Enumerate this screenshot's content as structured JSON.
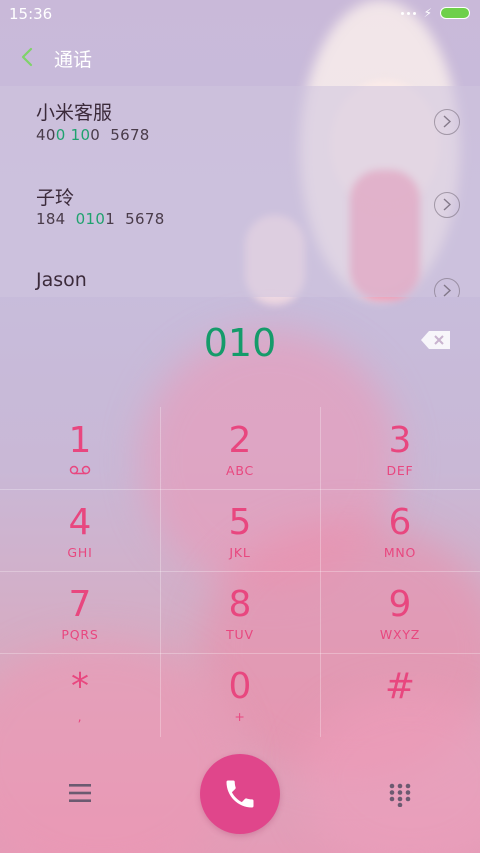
{
  "status_bar": {
    "time": "15:36"
  },
  "header": {
    "title": "通话"
  },
  "contacts": [
    {
      "name": "小米客服",
      "number_parts": [
        {
          "text": "40",
          "match": false
        },
        {
          "text": "0",
          "match": true
        },
        {
          "text": " ",
          "match": false
        },
        {
          "text": "10",
          "match": true
        },
        {
          "text": "0  5678",
          "match": false
        }
      ]
    },
    {
      "name": "子玲",
      "number_parts": [
        {
          "text": "184  ",
          "match": false
        },
        {
          "text": "010",
          "match": true
        },
        {
          "text": "1  5678",
          "match": false
        }
      ]
    },
    {
      "name": "Jason",
      "number_parts": []
    }
  ],
  "dialer": {
    "input_value": "010"
  },
  "keypad": [
    {
      "digit": "1",
      "letters": "",
      "sub_icon": "voicemail-icon"
    },
    {
      "digit": "2",
      "letters": "ABC"
    },
    {
      "digit": "3",
      "letters": "DEF"
    },
    {
      "digit": "4",
      "letters": "GHI"
    },
    {
      "digit": "5",
      "letters": "JKL"
    },
    {
      "digit": "6",
      "letters": "MNO"
    },
    {
      "digit": "7",
      "letters": "PQRS"
    },
    {
      "digit": "8",
      "letters": "TUV"
    },
    {
      "digit": "9",
      "letters": "WXYZ"
    },
    {
      "digit": "*",
      "letters": ","
    },
    {
      "digit": "0",
      "letters": "+"
    },
    {
      "digit": "#",
      "letters": ""
    }
  ],
  "colors": {
    "accent_pink": "#e8477f",
    "call_button": "#e0468b",
    "match_green": "#1fa26e",
    "battery_green": "#6ed04a"
  },
  "icons": {
    "back": "chevron-left-icon",
    "detail": "chevron-right-circle-icon",
    "backspace": "backspace-icon",
    "menu": "menu-icon",
    "call": "phone-icon",
    "dialpad": "dialpad-icon"
  }
}
